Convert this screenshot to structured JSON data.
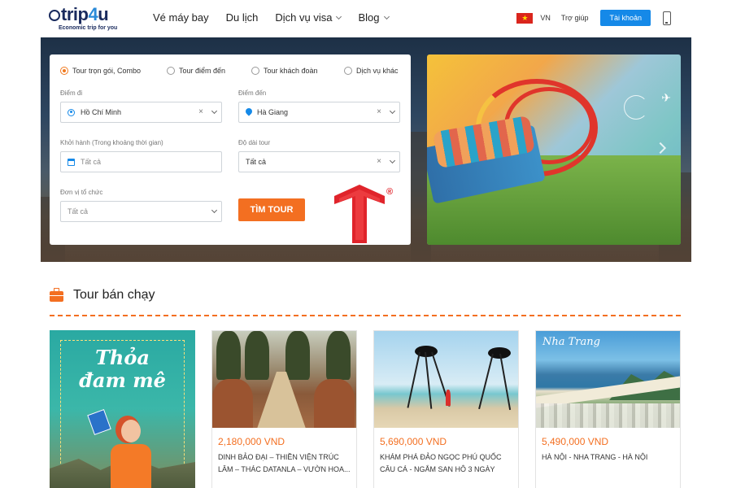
{
  "header": {
    "logo": {
      "text_e": "e",
      "text_trip": "trip",
      "text_4": "4",
      "text_u": "u",
      "tagline": "Economic trip for you"
    },
    "nav": [
      {
        "label": "Vé máy bay",
        "has_dropdown": false
      },
      {
        "label": "Du lịch",
        "has_dropdown": false
      },
      {
        "label": "Dịch vụ visa",
        "has_dropdown": true
      },
      {
        "label": "Blog",
        "has_dropdown": true
      }
    ],
    "language": "VN",
    "help": "Trợ giúp",
    "account_button": "Tài khoản",
    "icons": {
      "flag": "vietnam-flag-icon",
      "phone": "mobile-phone-icon"
    },
    "colors": {
      "primary": "#1589e8",
      "accent": "#f36f21"
    }
  },
  "search": {
    "tour_types": [
      {
        "label": "Tour trọn gói, Combo",
        "selected": true
      },
      {
        "label": "Tour điểm đến",
        "selected": false
      },
      {
        "label": "Tour khách đoàn",
        "selected": false
      },
      {
        "label": "Dịch vụ khác",
        "selected": false
      }
    ],
    "from_label": "Điểm đi",
    "from_value": "Hồ Chí Minh",
    "to_label": "Điểm đến",
    "to_value": "Hà Giang",
    "depart_label": "Khởi hành (Trong khoảng thời gian)",
    "depart_placeholder": "Tất cả",
    "duration_label": "Độ dài tour",
    "duration_value": "Tất cả",
    "organizer_label": "Đơn vị tổ chức",
    "organizer_placeholder": "Tất cả",
    "search_button": "TÌM TOUR",
    "clear_glyph": "×",
    "watermark_reg": "®"
  },
  "banner": {
    "next_icon": "chevron-right-icon",
    "plane_icon": "airplane-icon",
    "plane_glyph": "✈"
  },
  "best_sellers": {
    "title": "Tour bán chạy",
    "promo": {
      "line1": "Thỏa",
      "line2": "đam mê"
    },
    "tours": [
      {
        "price": "2,180,000 VND",
        "name": "DINH BẢO ĐẠI – THIỀN VIỆN TRÚC LÂM – THÁC DATANLA – VƯỜN HOA..."
      },
      {
        "price": "5,690,000 VND",
        "name": "KHÁM PHÁ ĐẢO NGỌC PHÚ QUỐC CÂU CÁ - NGẮM SAN HÔ 3 NGÀY"
      },
      {
        "price": "5,490,000 VND",
        "name": "HÀ NỘI - NHA TRANG - HÀ NỘI",
        "image_caption": "Nha Trang"
      }
    ]
  }
}
